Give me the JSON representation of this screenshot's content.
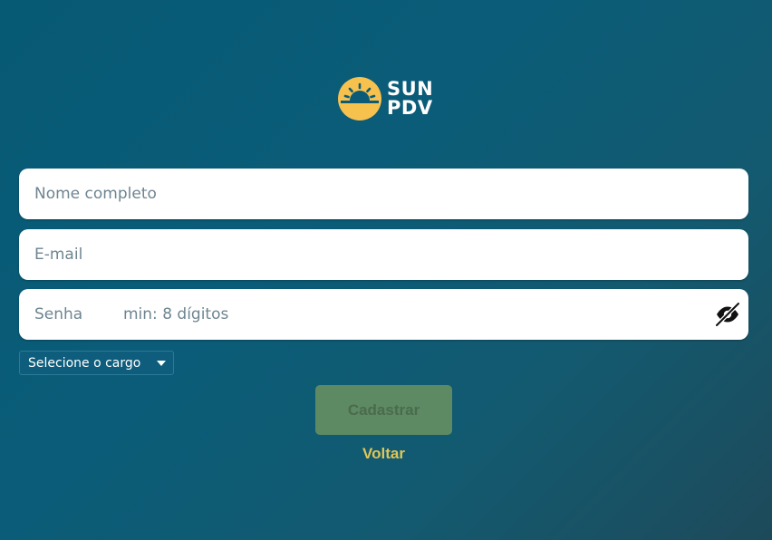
{
  "brand": {
    "line1": "SUN",
    "line2": "PDV",
    "logo_icon": "sun-logo-icon",
    "logo_color": "#f7c14e"
  },
  "form": {
    "name_placeholder": "Nome completo",
    "email_placeholder": "E-mail",
    "password_label": "Senha",
    "password_placeholder": "min: 8 dígitos",
    "password_toggle_icon": "eye-slash-icon",
    "role_select": {
      "selected": "Selecione o cargo"
    },
    "submit_label": "Cadastrar",
    "back_label": "Voltar"
  },
  "colors": {
    "background": "#0a5c78",
    "submit_button": "#5d8a62",
    "back_link": "#e0c658"
  }
}
